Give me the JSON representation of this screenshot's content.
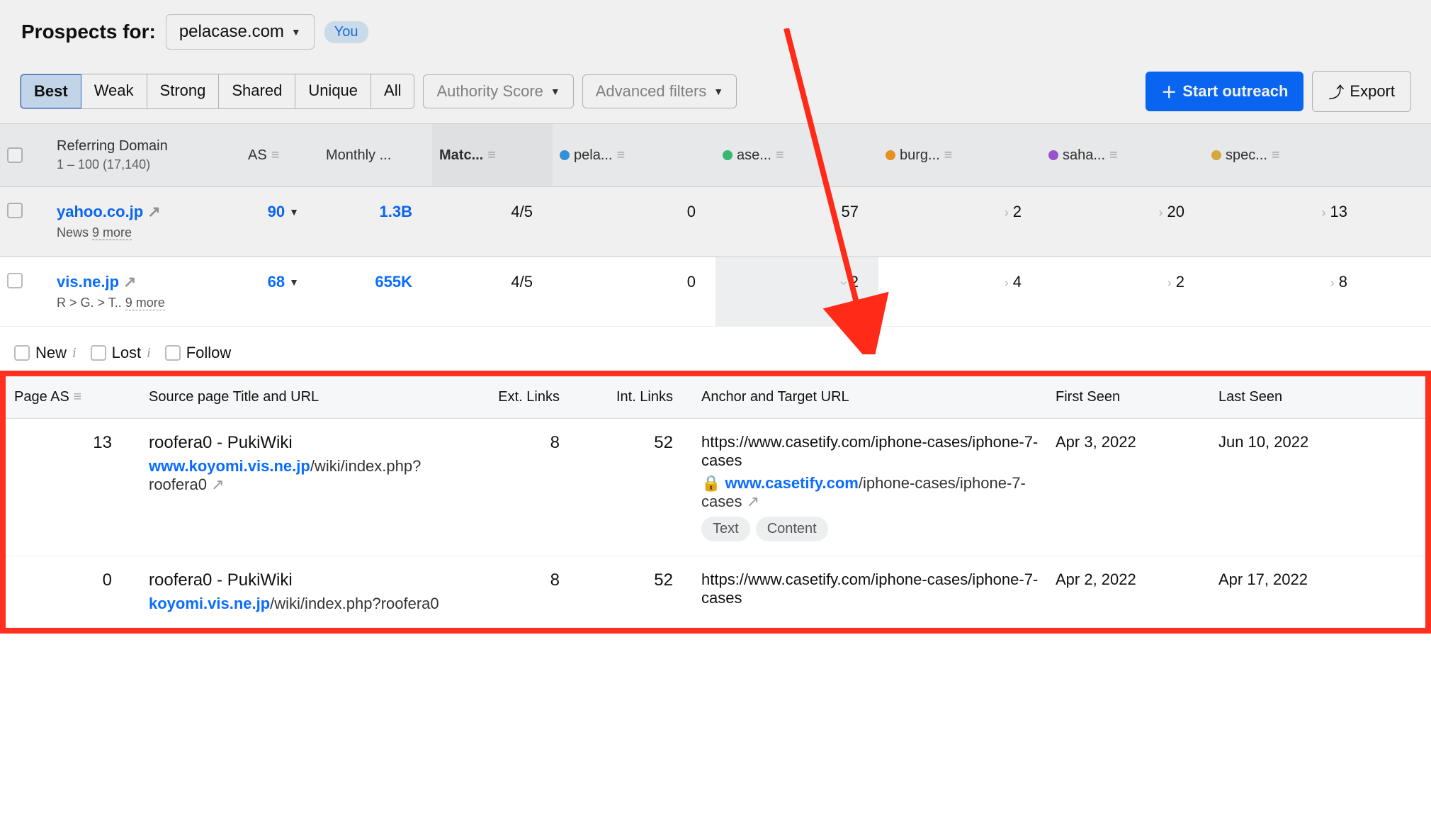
{
  "header": {
    "title": "Prospects for:",
    "domain": "pelacase.com",
    "you_badge": "You"
  },
  "tabs": [
    "Best",
    "Weak",
    "Strong",
    "Shared",
    "Unique",
    "All"
  ],
  "active_tab": 0,
  "filters": {
    "authority_score": "Authority Score",
    "advanced": "Advanced filters"
  },
  "actions": {
    "outreach": "Start outreach",
    "export": "Export"
  },
  "columns": {
    "referring_domain": "Referring Domain",
    "referring_domain_sub": "1 – 100 (17,140)",
    "as": "AS",
    "monthly": "Monthly ...",
    "matches": "Matc...",
    "competitors": [
      {
        "label": "pela...",
        "color": "#3b9ae1"
      },
      {
        "label": "ase...",
        "color": "#3bc47a"
      },
      {
        "label": "burg...",
        "color": "#f59a23"
      },
      {
        "label": "saha...",
        "color": "#a259d9"
      },
      {
        "label": "spec...",
        "color": "#e3b341"
      }
    ]
  },
  "rows": [
    {
      "domain": "yahoo.co.jp",
      "meta_prefix": "News",
      "meta_more": "9 more",
      "as": "90",
      "monthly": "1.3B",
      "matches": "4/5",
      "vals": [
        "0",
        "57",
        "2",
        "20",
        "13"
      ]
    },
    {
      "domain": "vis.ne.jp",
      "meta_prefix": "R > G. > T..",
      "meta_more": "9 more",
      "as": "68",
      "monthly": "655K",
      "matches": "4/5",
      "vals": [
        "0",
        "2",
        "4",
        "2",
        "8"
      ]
    }
  ],
  "detail_filters": {
    "new": "New",
    "lost": "Lost",
    "follow": "Follow"
  },
  "detail_columns": {
    "page_as": "Page AS",
    "source": "Source page Title and URL",
    "ext_links": "Ext. Links",
    "int_links": "Int. Links",
    "anchor": "Anchor and Target URL",
    "first_seen": "First Seen",
    "last_seen": "Last Seen"
  },
  "detail_rows": [
    {
      "page_as": "13",
      "title": "roofera0 - PukiWiki",
      "url_blue": "www.koyomi.vis.ne.jp",
      "url_tail": "/wiki/index.php?roofera0",
      "ext_links": "8",
      "int_links": "52",
      "anchor_text": "https://www.casetify.com/iphone-cases/iphone-7-cases",
      "target_blue": "www.casetify.com",
      "target_tail": "/iphone-cases/iphone-7-cases",
      "tags": [
        "Text",
        "Content"
      ],
      "first_seen": "Apr 3, 2022",
      "last_seen": "Jun 10, 2022"
    },
    {
      "page_as": "0",
      "title": "roofera0 - PukiWiki",
      "url_blue": "koyomi.vis.ne.jp",
      "url_tail": "/wiki/index.php?roofera0",
      "ext_links": "8",
      "int_links": "52",
      "anchor_text": "https://www.casetify.com/iphone-cases/iphone-7-cases",
      "target_blue": "",
      "target_tail": "",
      "tags": [],
      "first_seen": "Apr 2, 2022",
      "last_seen": "Apr 17, 2022"
    }
  ]
}
